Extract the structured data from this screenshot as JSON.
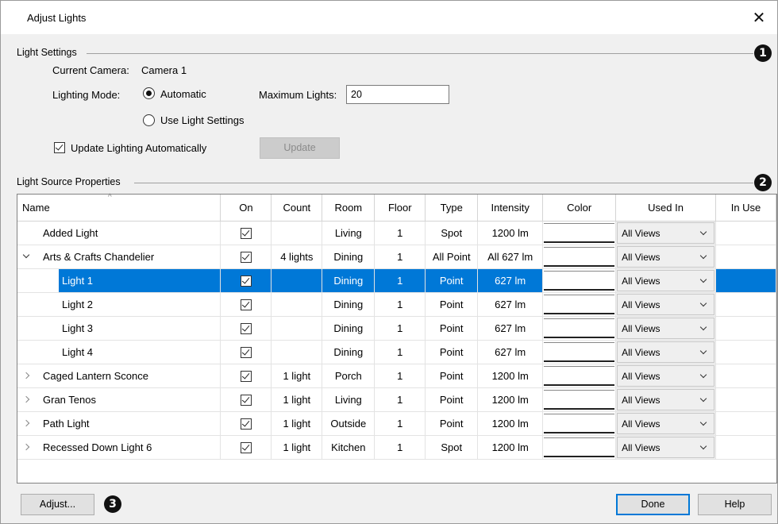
{
  "window": {
    "title": "Adjust Lights",
    "close_glyph": "✕"
  },
  "light_settings": {
    "group_label": "Light Settings",
    "callout": "1",
    "current_camera_label": "Current Camera:",
    "current_camera_value": "Camera 1",
    "lighting_mode_label": "Lighting Mode:",
    "mode_automatic": "Automatic",
    "mode_use_light_settings": "Use Light Settings",
    "selected_mode": "Automatic",
    "max_lights_label": "Maximum Lights:",
    "max_lights_value": "20",
    "update_auto_label": "Update Lighting Automatically",
    "update_auto_checked": true,
    "update_button": "Update"
  },
  "light_source_properties": {
    "group_label": "Light Source Properties",
    "callout": "2",
    "columns": [
      "Name",
      "On",
      "Count",
      "Room",
      "Floor",
      "Type",
      "Intensity",
      "Color",
      "Used In",
      "In Use"
    ],
    "rows": [
      {
        "name": "Added Light",
        "level": 0,
        "expander": "none",
        "on": true,
        "count": "",
        "room": "Living",
        "floor": "1",
        "type": "Spot",
        "intensity": "1200 lm",
        "used_in": "All Views",
        "selected": false
      },
      {
        "name": "Arts & Crafts Chandelier",
        "level": 0,
        "expander": "expanded",
        "on": true,
        "count": "4 lights",
        "room": "Dining",
        "floor": "1",
        "type": "All Point",
        "intensity": "All 627 lm",
        "used_in": "All Views",
        "selected": false
      },
      {
        "name": "Light 1",
        "level": 1,
        "expander": "none",
        "on": true,
        "count": "",
        "room": "Dining",
        "floor": "1",
        "type": "Point",
        "intensity": "627 lm",
        "used_in": "All Views",
        "selected": true
      },
      {
        "name": "Light 2",
        "level": 1,
        "expander": "none",
        "on": true,
        "count": "",
        "room": "Dining",
        "floor": "1",
        "type": "Point",
        "intensity": "627 lm",
        "used_in": "All Views",
        "selected": false
      },
      {
        "name": "Light 3",
        "level": 1,
        "expander": "none",
        "on": true,
        "count": "",
        "room": "Dining",
        "floor": "1",
        "type": "Point",
        "intensity": "627 lm",
        "used_in": "All Views",
        "selected": false
      },
      {
        "name": "Light 4",
        "level": 1,
        "expander": "none",
        "on": true,
        "count": "",
        "room": "Dining",
        "floor": "1",
        "type": "Point",
        "intensity": "627 lm",
        "used_in": "All Views",
        "selected": false
      },
      {
        "name": "Caged Lantern Sconce",
        "level": 0,
        "expander": "collapsed",
        "on": true,
        "count": "1 light",
        "room": "Porch",
        "floor": "1",
        "type": "Point",
        "intensity": "1200 lm",
        "used_in": "All Views",
        "selected": false
      },
      {
        "name": "Gran Tenos",
        "level": 0,
        "expander": "collapsed",
        "on": true,
        "count": "1 light",
        "room": "Living",
        "floor": "1",
        "type": "Point",
        "intensity": "1200 lm",
        "used_in": "All Views",
        "selected": false
      },
      {
        "name": "Path Light",
        "level": 0,
        "expander": "collapsed",
        "on": true,
        "count": "1 light",
        "room": "Outside",
        "floor": "1",
        "type": "Point",
        "intensity": "1200 lm",
        "used_in": "All Views",
        "selected": false
      },
      {
        "name": "Recessed Down Light 6",
        "level": 0,
        "expander": "collapsed",
        "on": true,
        "count": "1 light",
        "room": "Kitchen",
        "floor": "1",
        "type": "Spot",
        "intensity": "1200 lm",
        "used_in": "All Views",
        "selected": false
      }
    ]
  },
  "footer": {
    "adjust_button": "Adjust...",
    "callout": "3",
    "done_button": "Done",
    "help_button": "Help"
  },
  "colors": {
    "selection": "#0078d7",
    "dialog_bg": "#f0f0f0"
  }
}
